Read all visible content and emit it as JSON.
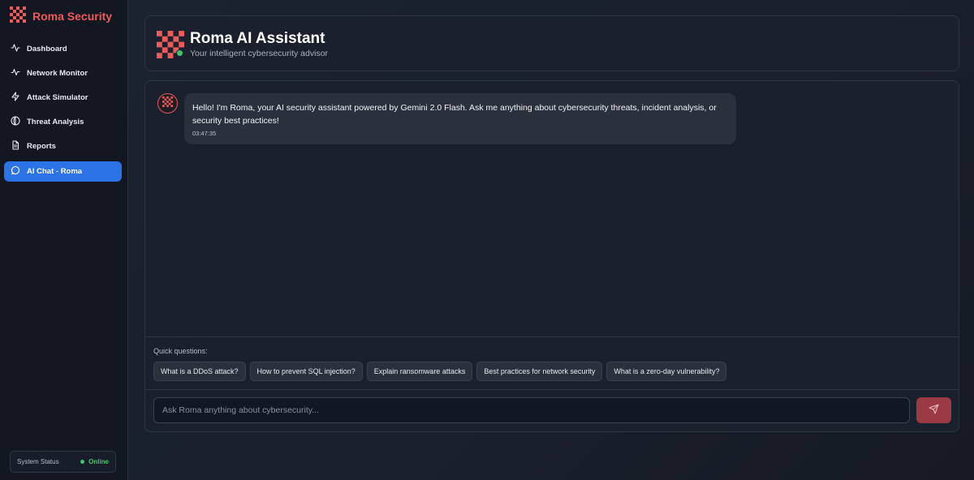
{
  "app": {
    "brand": "Roma Security",
    "brand_color": "#ef5b5b"
  },
  "sidebar": {
    "items": [
      {
        "label": "Dashboard",
        "icon": "activity-icon",
        "active": false
      },
      {
        "label": "Network Monitor",
        "icon": "pulse-icon",
        "active": false
      },
      {
        "label": "Attack Simulator",
        "icon": "lightning-icon",
        "active": false
      },
      {
        "label": "Threat Analysis",
        "icon": "globe-icon",
        "active": false
      },
      {
        "label": "Reports",
        "icon": "document-icon",
        "active": false
      },
      {
        "label": "AI Chat - Roma",
        "icon": "chat-bubble-icon",
        "active": true
      }
    ],
    "status": {
      "label": "System Status",
      "value": "Online",
      "color": "#3fc56b"
    }
  },
  "header": {
    "title": "Roma AI Assistant",
    "subtitle": "Your intelligent cybersecurity advisor"
  },
  "chat": {
    "messages": [
      {
        "sender": "bot",
        "text": "Hello! I'm Roma, your AI security assistant powered by Gemini 2.0 Flash. Ask me anything about cybersecurity threats, incident analysis, or security best practices!",
        "time": "03:47:35"
      }
    ],
    "quick_label": "Quick questions:",
    "quick_questions": [
      "What is a DDoS attack?",
      "How to prevent SQL injection?",
      "Explain ransomware attacks",
      "Best practices for network security",
      "What is a zero-day vulnerability?"
    ],
    "input_placeholder": "Ask Roma anything about cybersecurity...",
    "input_value": ""
  },
  "colors": {
    "accent": "#2b73e6",
    "send_button": "#9b3a44"
  }
}
